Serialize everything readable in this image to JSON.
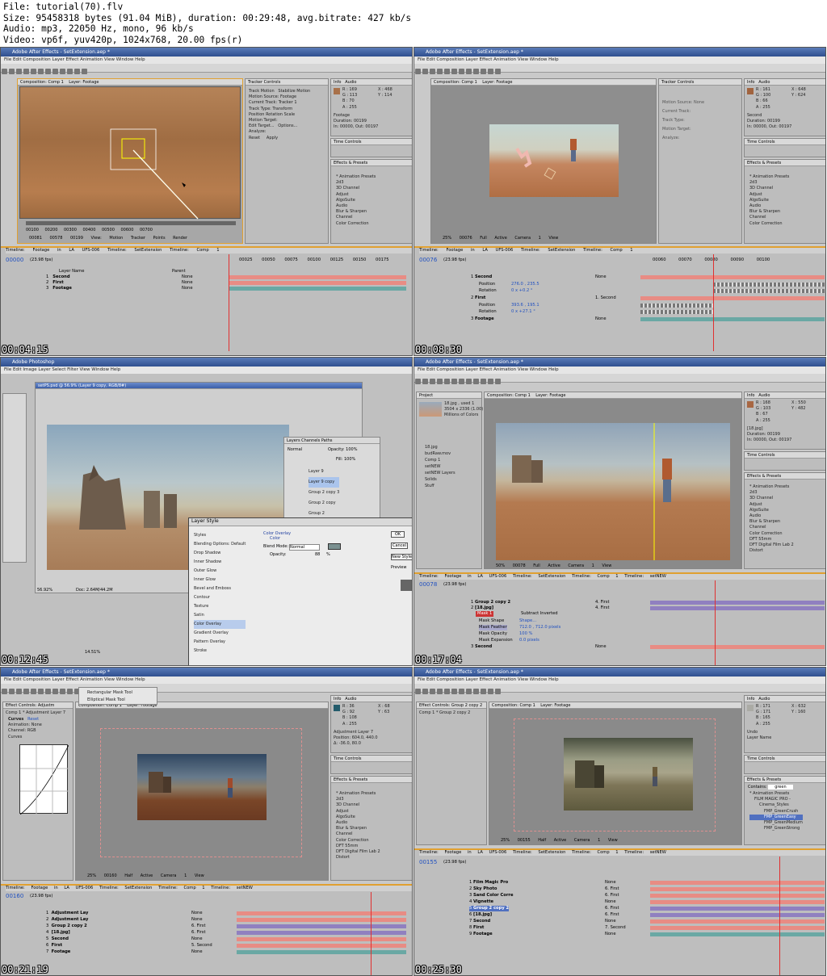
{
  "file_info": {
    "line1": "File: tutorial(70).flv",
    "line2": "Size: 95458318 bytes (91.04 MiB), duration: 00:29:48, avg.bitrate: 427 kb/s",
    "line3": "Audio: mp3, 22050 Hz, mono, 96 kb/s",
    "line4": "Video: vp6f, yuv420p, 1024x768, 20.00 fps(r)"
  },
  "colors": {
    "title_bar": "#2f4f8f",
    "timeline_accent": "#e0a030",
    "playhead": "#e03030",
    "salmon_bar": "#e88c84",
    "teal_bar": "#6aa8a4",
    "violet_bar": "#9080c0"
  },
  "ae_menu": "File  Edit  Composition  Layer  Effect  Animation  View  Window  Help",
  "frames": [
    {
      "timestamp": "00:04:15",
      "title": "Adobe After Effects - SetExtension.aep *",
      "comp_tab": "Composition: Comp 1",
      "layer_tab": "Layer: Footage",
      "tracker_title": "Tracker Controls",
      "track_motion": "Track Motion",
      "stabilize": "Stabilize Motion",
      "info": [
        "R : 169",
        "G : 113",
        "B : 70",
        "A : 255",
        "X : 468",
        "Y : 114"
      ],
      "info_extra": [
        "Footage",
        "Duration: 00199",
        "In: 00000, Out: 00197"
      ],
      "tracker_lines": [
        "Motion Source: Footage",
        "Current Track: Tracker 1",
        "Track Type: Transform",
        "Position",
        "Rotation",
        "Scale",
        "Motion Target:",
        "Edit Target...",
        "Options...",
        "Analyze:",
        "Reset",
        "Apply"
      ],
      "effects_title": "Effects & Presets",
      "time_controls": "Time Controls",
      "effects": [
        "* Animation Presets",
        "2d3",
        "3D Channel",
        "Adjust",
        "AlgoSuite",
        "Audio",
        "Blur & Sharpen",
        "Channel",
        "Color Correction"
      ],
      "viewer_footer": [
        "00081",
        "00578",
        "00199",
        "View:",
        "Motion Tracker Points",
        "Render"
      ],
      "ruler": [
        "00100",
        "00200",
        "00300",
        "00400",
        "00500",
        "00600",
        "00700"
      ],
      "tl_tabs": [
        "Timeline: Footage in LA UFS-006",
        "Timeline: SetExtension",
        "Timeline: Comp 1"
      ],
      "timecode": "00000",
      "fps": "(23.98 fps)",
      "layer_header": "Layer Name",
      "parent_header": "Parent",
      "layers": [
        {
          "n": "1",
          "name": "Second",
          "parent": "None"
        },
        {
          "n": "2",
          "name": "First",
          "parent": "None"
        },
        {
          "n": "3",
          "name": "Footage",
          "parent": "None"
        }
      ],
      "tl_ruler": [
        "00025",
        "00050",
        "00075",
        "00100",
        "00125",
        "00150",
        "00175"
      ]
    },
    {
      "timestamp": "00:08:30",
      "title": "Adobe After Effects - SetExtension.aep *",
      "comp_tab": "Composition: Comp 1",
      "layer_tab": "Layer: Footage",
      "info": [
        "R : 161",
        "G : 100",
        "B : 66",
        "A : 255",
        "X : 648",
        "Y : 624"
      ],
      "info_extra": [
        "Second",
        "Duration: 00199",
        "In: 00000, Out: 00197"
      ],
      "tracker_lines": [
        "Motion Source: None",
        "Current Track:",
        "Track Type:",
        "Motion Target:",
        "Analyze:"
      ],
      "effects": [
        "* Animation Presets",
        "2d3",
        "3D Channel",
        "Adjust",
        "AlgoSuite",
        "Audio",
        "Blur & Sharpen",
        "Channel",
        "Color Correction"
      ],
      "viewer_footer": [
        "25%",
        "00076",
        "Full",
        "Active Camera",
        "1 View"
      ],
      "tl_tabs": [
        "Timeline: Footage in LA UFS-006",
        "Timeline: SetExtension",
        "Timeline: Comp 1"
      ],
      "timecode": "00076",
      "fps": "(23.98 fps)",
      "layers": [
        {
          "n": "1",
          "name": "Second",
          "parent": "None"
        },
        {
          "n": "",
          "name": "Position",
          "parent": "276.0 , 235.5"
        },
        {
          "n": "",
          "name": "Rotation",
          "parent": "0 x +0.2 °"
        },
        {
          "n": "2",
          "name": "First",
          "parent": "1. Second"
        },
        {
          "n": "",
          "name": "Position",
          "parent": "393.6 , 195.1"
        },
        {
          "n": "",
          "name": "Rotation",
          "parent": "0 x +27.1 °"
        },
        {
          "n": "3",
          "name": "Footage",
          "parent": "None"
        }
      ],
      "tl_ruler": [
        "00060",
        "00070",
        "00080",
        "00090",
        "00100"
      ]
    },
    {
      "timestamp": "00:12:45",
      "title": "Adobe Photoshop",
      "ps_menu": "File  Edit  Image  Layer  Select  Filter  View  Window  Help",
      "doc_title": "setPS.psd @ 56.9% (Layer 9 copy, RGB/8#)",
      "zoom": "56.92%",
      "doc_size": "Doc: 2.64M/44.2M",
      "zoom2": "14.51%",
      "layers_tabs": [
        "Layers",
        "Channels",
        "Paths"
      ],
      "blend": "Normal",
      "opacity_label": "Opacity:",
      "opacity": "100%",
      "fill_label": "Fill:",
      "fill": "100%",
      "ps_layers": [
        "Layer 9",
        "Layer 9 copy",
        "Group 2 copy 3",
        "Group 2 copy",
        "Group 2"
      ],
      "layer_style_title": "Layer Style",
      "styles": [
        "Styles",
        "Blending Options: Default",
        "Drop Shadow",
        "Inner Shadow",
        "Outer Glow",
        "Inner Glow",
        "Bevel and Emboss",
        "Contour",
        "Texture",
        "Satin",
        "Color Overlay",
        "Gradient Overlay",
        "Pattern Overlay",
        "Stroke"
      ],
      "overlay_heading": "Color Overlay",
      "overlay_sub": "Color",
      "blend_mode_label": "Blend Mode:",
      "blend_mode": "Normal",
      "opacity2_label": "Opacity:",
      "opacity2": "88",
      "pct": "%",
      "buttons": [
        "OK",
        "Cancel",
        "New Style...",
        "Preview"
      ]
    },
    {
      "timestamp": "00:17:04",
      "title": "Adobe After Effects - SetExtension.aep *",
      "project_tab": "Project",
      "proj_info": [
        "18.jpg , used 1",
        "3504 x 2336 (1.00)",
        "Millions of Colors"
      ],
      "proj_items": [
        "18.jpg",
        "budRaw.mov",
        "Comp 1",
        "setNEW",
        "setNEW Layers",
        "Solids",
        "Stuff"
      ],
      "comp_tab": "Composition: Comp 1",
      "layer_tab": "Layer: Footage",
      "info": [
        "R : 168",
        "G : 103",
        "B : 67",
        "A : 255",
        "X : 550",
        "Y : 482"
      ],
      "info_extra": [
        "[18.jpg]",
        "Duration: 00199",
        "In: 00000, Out: 00197"
      ],
      "effects": [
        "* Animation Presets",
        "2d3",
        "3D Channel",
        "Adjust",
        "AlgoSuite",
        "Audio",
        "Blur & Sharpen",
        "Channel",
        "Color Correction",
        "DFT 55mm",
        "DFT Digital Film Lab 2",
        "Distort"
      ],
      "viewer_footer": [
        "50%",
        "00078",
        "Full",
        "Active Camera",
        "1 View"
      ],
      "tl_tabs": [
        "Timeline: Footage in LA UFS-006",
        "Timeline: SetExtension",
        "Timeline: Comp 1",
        "Timeline: setNEW"
      ],
      "timecode": "00078",
      "fps": "(23.98 fps)",
      "layers": [
        {
          "n": "1",
          "name": "Group 2 copy 2",
          "parent": "4. First"
        },
        {
          "n": "2",
          "name": "[18.jpg]",
          "parent": "4. First"
        },
        {
          "n": "",
          "name": "Mask 1",
          "parent": "Subtract   Inverted"
        },
        {
          "n": "",
          "name": "Mask Shape",
          "parent": "Shape..."
        },
        {
          "n": "",
          "name": "Mask Feather",
          "parent": "712.0 , 712.0 pixels"
        },
        {
          "n": "",
          "name": "Mask Opacity",
          "parent": "100 %"
        },
        {
          "n": "",
          "name": "Mask Expansion",
          "parent": "0.0 pixels"
        },
        {
          "n": "3",
          "name": "Second",
          "parent": "None"
        }
      ]
    },
    {
      "timestamp": "00:21:19",
      "title": "Adobe After Effects - SetExtension.aep *",
      "mask_tools": [
        "Rectangular Mask Tool",
        "Elliptical Mask Tool"
      ],
      "fx_tab": "Effect Controls: Adjustm",
      "fx_sub": "Comp 1 * Adjustment Layer 7",
      "curves": "Curves",
      "reset": "Reset",
      "animation": "Animation:",
      "animation_val": "None",
      "channel": "Channel:",
      "channel_val": "RGB",
      "curves_lbl": "Curves",
      "info": [
        "R : 36",
        "G : 92",
        "B : 108",
        "A : 255",
        "X : 68",
        "Y : 63"
      ],
      "info_extra": [
        "Adjustment Layer 7",
        "Position: 604.0, 440.0",
        "Δ: -36.0, 80.0"
      ],
      "effects": [
        "* Animation Presets",
        "2d3",
        "3D Channel",
        "Adjust",
        "AlgoSuite",
        "Audio",
        "Blur & Sharpen",
        "Channel",
        "Color Correction",
        "DFT 55mm",
        "DFT Digital Film Lab 2",
        "Distort"
      ],
      "viewer_footer": [
        "25%",
        "00160",
        "Half",
        "Active Camera",
        "1 View"
      ],
      "tl_tabs": [
        "Timeline: Footage in LA UFS-006",
        "Timeline: SetExtension",
        "Timeline: Comp 1",
        "Timeline: setNEW"
      ],
      "timecode": "00160",
      "fps": "(23.98 fps)",
      "layers": [
        {
          "n": "1",
          "name": "Adjustment Lay",
          "parent": "None"
        },
        {
          "n": "2",
          "name": "Adjustment Lay",
          "parent": "None"
        },
        {
          "n": "3",
          "name": "Group 2 copy 2",
          "parent": "6. First"
        },
        {
          "n": "4",
          "name": "[18.jpg]",
          "parent": "6. First"
        },
        {
          "n": "5",
          "name": "Second",
          "parent": "None"
        },
        {
          "n": "6",
          "name": "First",
          "parent": "5. Second"
        },
        {
          "n": "7",
          "name": "Footage",
          "parent": "None"
        }
      ]
    },
    {
      "timestamp": "00:25:30",
      "title": "Adobe After Effects - SetExtension.aep *",
      "fx_tab": "Effect Controls: Group 2 copy 2",
      "fx_sub": "Comp 1 * Group 2 copy 2",
      "info": [
        "R : 171",
        "G : 171",
        "B : 165",
        "A : 255",
        "X : 632",
        "Y : 160"
      ],
      "info_extra": [
        "Undo",
        "Layer Name"
      ],
      "contains": "green",
      "effects": [
        "* Animation Presets",
        "FILM MAGIC PRO -",
        "Cinema_Styles",
        "FMP_GreenCrush",
        "FMP_GreenEasy",
        "FMP_GreenMedium",
        "FMP_GreenStrong"
      ],
      "viewer_footer": [
        "25%",
        "00155",
        "Half",
        "Active Camera",
        "1 View"
      ],
      "tl_tabs": [
        "Timeline: Footage in LA UFS-006",
        "Timeline: SetExtension",
        "Timeline: Comp 1",
        "Timeline: setNEW"
      ],
      "timecode": "00155",
      "fps": "(23.98 fps)",
      "layers": [
        {
          "n": "1",
          "name": "Film Magic Pro",
          "parent": "None"
        },
        {
          "n": "2",
          "name": "Sky Photo",
          "parent": "6. First"
        },
        {
          "n": "3",
          "name": "Sand Color Corre",
          "parent": "6. First"
        },
        {
          "n": "4",
          "name": "Vignette",
          "parent": "None"
        },
        {
          "n": "5",
          "name": "Group 2 copy 2",
          "parent": "6. First"
        },
        {
          "n": "6",
          "name": "[18.jpg]",
          "parent": "6. First"
        },
        {
          "n": "7",
          "name": "Second",
          "parent": "None"
        },
        {
          "n": "8",
          "name": "First",
          "parent": "7. Second"
        },
        {
          "n": "9",
          "name": "Footage",
          "parent": "None"
        }
      ]
    }
  ]
}
